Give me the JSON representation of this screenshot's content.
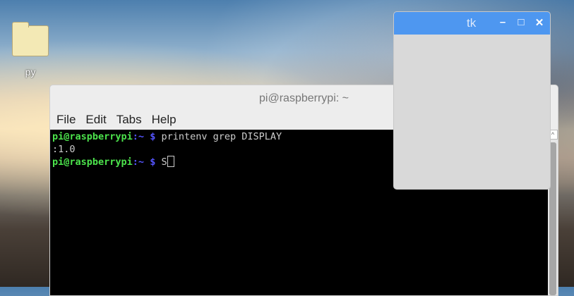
{
  "desktop": {
    "icons": [
      {
        "label": "py"
      }
    ]
  },
  "terminal": {
    "title": "pi@raspberrypi: ~",
    "menu": [
      "File",
      "Edit",
      "Tabs",
      "Help"
    ],
    "lines": [
      {
        "user": "pi@raspberrypi",
        "path": ":~",
        "prompt": " $ ",
        "cmd": "printenv grep DISPLAY"
      },
      {
        "output": ":1.0"
      },
      {
        "user": "pi@raspberrypi",
        "path": ":~",
        "prompt": " $ ",
        "cmd": "S"
      }
    ]
  },
  "tk": {
    "title": "tk",
    "minimize": "–",
    "maximize": "□",
    "close": "✕"
  }
}
